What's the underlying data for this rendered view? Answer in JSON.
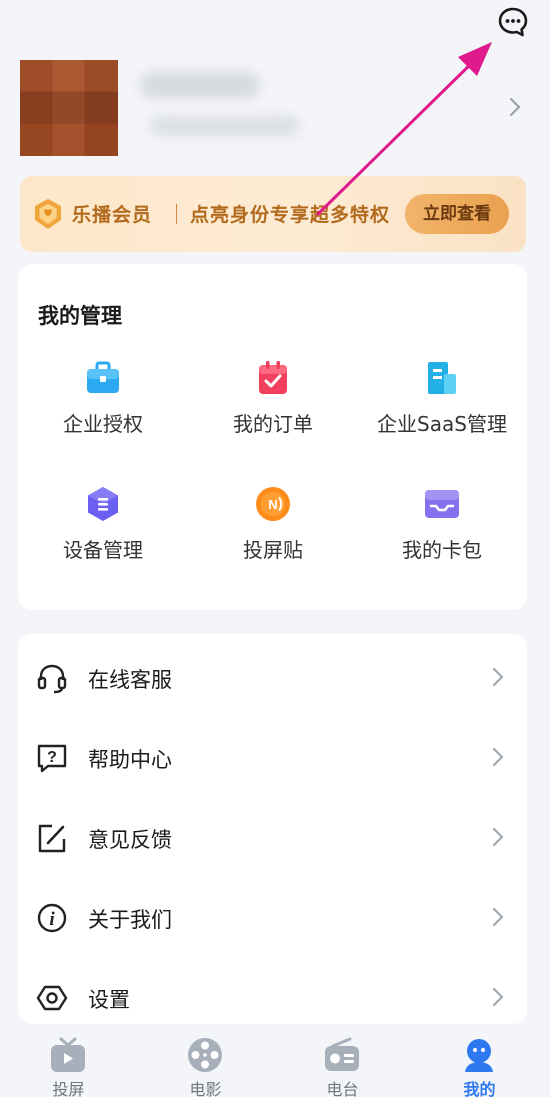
{
  "colors": {
    "accent": "#2e79f0",
    "vip_text": "#b26a1c",
    "annotation_arrow": "#e0198c"
  },
  "top_bar": {
    "message_icon": "chat-bubble-icon"
  },
  "profile": {
    "avatar_icon": "avatar"
  },
  "vip": {
    "title": "乐播会员",
    "desc": "点亮身份专享超多特权",
    "button": "立即查看"
  },
  "management": {
    "title": "我的管理",
    "items": [
      {
        "label": "企业授权",
        "icon": "briefcase-icon"
      },
      {
        "label": "我的订单",
        "icon": "order-icon"
      },
      {
        "label": "企业SaaS管理",
        "icon": "building-icon"
      },
      {
        "label": "设备管理",
        "icon": "device-icon"
      },
      {
        "label": "投屏贴",
        "icon": "nfc-icon"
      },
      {
        "label": "我的卡包",
        "icon": "wallet-icon"
      }
    ]
  },
  "menu": [
    {
      "label": "在线客服",
      "icon": "headset-icon"
    },
    {
      "label": "帮助中心",
      "icon": "help-icon"
    },
    {
      "label": "意见反馈",
      "icon": "feedback-icon"
    },
    {
      "label": "关于我们",
      "icon": "info-icon"
    },
    {
      "label": "设置",
      "icon": "settings-icon"
    }
  ],
  "tabs": [
    {
      "label": "投屏",
      "icon": "tv-icon",
      "active": false
    },
    {
      "label": "电影",
      "icon": "film-reel-icon",
      "active": false
    },
    {
      "label": "电台",
      "icon": "radio-icon",
      "active": false
    },
    {
      "label": "我的",
      "icon": "profile-icon",
      "active": true
    }
  ]
}
